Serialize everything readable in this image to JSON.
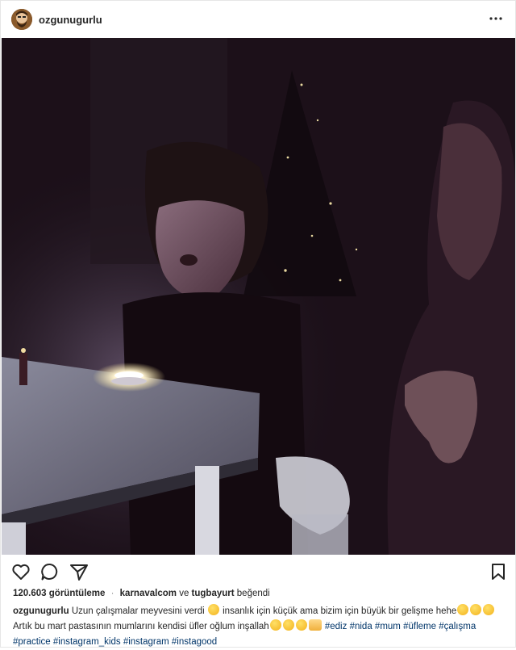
{
  "header": {
    "username": "ozgunugurlu"
  },
  "stats": {
    "views": "120.603 görüntüleme",
    "separator": "·",
    "liker1": "karnavalcom",
    "and": "ve",
    "liker2": "tugbayurt",
    "liked": "beğendi"
  },
  "caption": {
    "username": "ozgunugurlu",
    "text1": "Uzun çalışmalar meyvesini verdi",
    "text2": "insanlık için küçük ama bizim için büyük bir gelişme hehe",
    "text3": "Artık bu mart pastasının mumlarını kendisi üfler oğlum inşallah",
    "hashtags_line1": [
      "#ediz",
      "#nida",
      "#mum",
      "#üfleme",
      "#çalışma"
    ],
    "hashtags_line2": [
      "#practice",
      "#instagram_kids",
      "#instagram",
      "#instagood"
    ]
  },
  "icons": {
    "heart": "heart-icon",
    "comment": "comment-icon",
    "share": "share-icon",
    "save": "bookmark-icon",
    "more": "more-icon"
  }
}
